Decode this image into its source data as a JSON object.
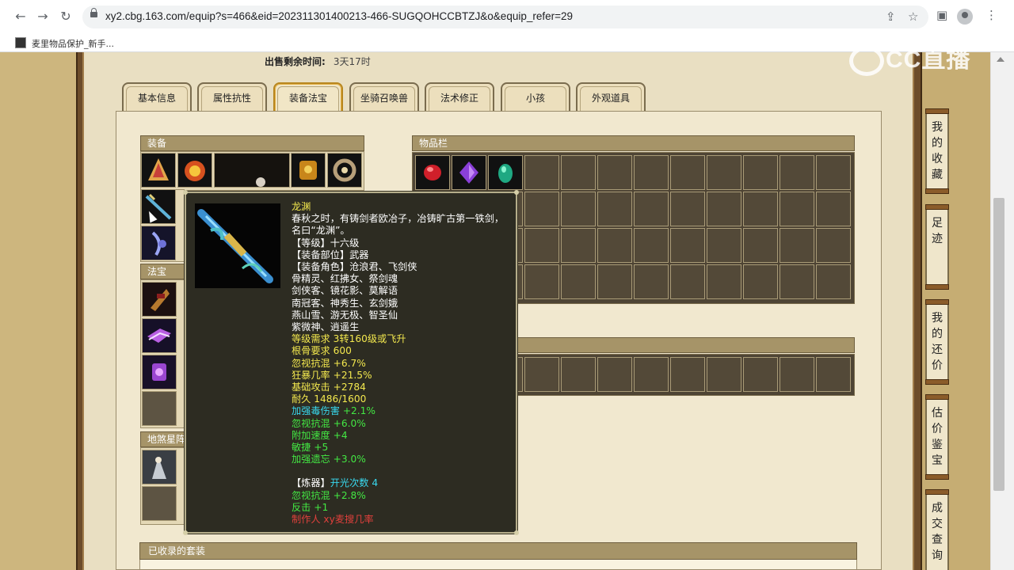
{
  "browser": {
    "url": "xy2.cbg.163.com/equip?s=466&eid=202311301400213-466-SUGQOHCCBTZJ&o&equip_refer=29",
    "bookmark_label": "麦里物品保护_新手..."
  },
  "watermark": "CC直播",
  "sale": {
    "remain_label": "出售剩余时间:",
    "remain_value": "3天17时"
  },
  "tabs": [
    {
      "label": "基本信息"
    },
    {
      "label": "属性抗性"
    },
    {
      "label": "装备法宝"
    },
    {
      "label": "坐骑召唤兽"
    },
    {
      "label": "法术修正"
    },
    {
      "label": "小孩"
    },
    {
      "label": "外观道具"
    }
  ],
  "active_tab": "装备法宝",
  "panels": {
    "equip": "装备",
    "fabao": "法宝",
    "inventory": "物品栏",
    "disha": "地煞星阵",
    "sets": "已收录的套装"
  },
  "right_buttons": [
    "我的收藏",
    "足迹",
    "我的还价",
    "估价鉴宝",
    "成交查询"
  ],
  "tooltip": {
    "name": "龙渊",
    "desc_lines": [
      "春秋之时，有铸剑者欧冶子，冶铸旷古第一铁剑，",
      "名曰“龙渊”。"
    ],
    "level": "【等级】十六级",
    "slot": "【装备部位】武器",
    "roles_label": "【装备角色】沧浪君、飞剑侠",
    "role_lines": [
      "骨精灵、红拂女、祭剑魂",
      "剑侠客、镜花影、莫解语",
      "南冠客、神秀生、玄剑娥",
      "燕山雪、游无极、智圣仙",
      "紫微神、逍遥生"
    ],
    "requirements": [
      "等级需求 3转160级或飞升",
      "根骨要求 600"
    ],
    "base_attrs": [
      "忽视抗混 +6.7%",
      "狂暴几率 +21.5%",
      "基础攻击 +2784",
      "耐久 1486/1600"
    ],
    "extra_first_label": "加强毒伤害",
    "extra_first_value": "+2.1%",
    "extra_attrs": [
      "忽视抗混 +6.0%",
      "附加速度 +4",
      "敏捷 +5",
      "加强遗忘 +3.0%"
    ],
    "refine_label": "【炼器】",
    "refine_value": "开光次数 4",
    "refine_attrs": [
      "忽视抗混 +2.8%",
      "反击 +1"
    ],
    "maker": "制作人 xy麦搜几率"
  }
}
